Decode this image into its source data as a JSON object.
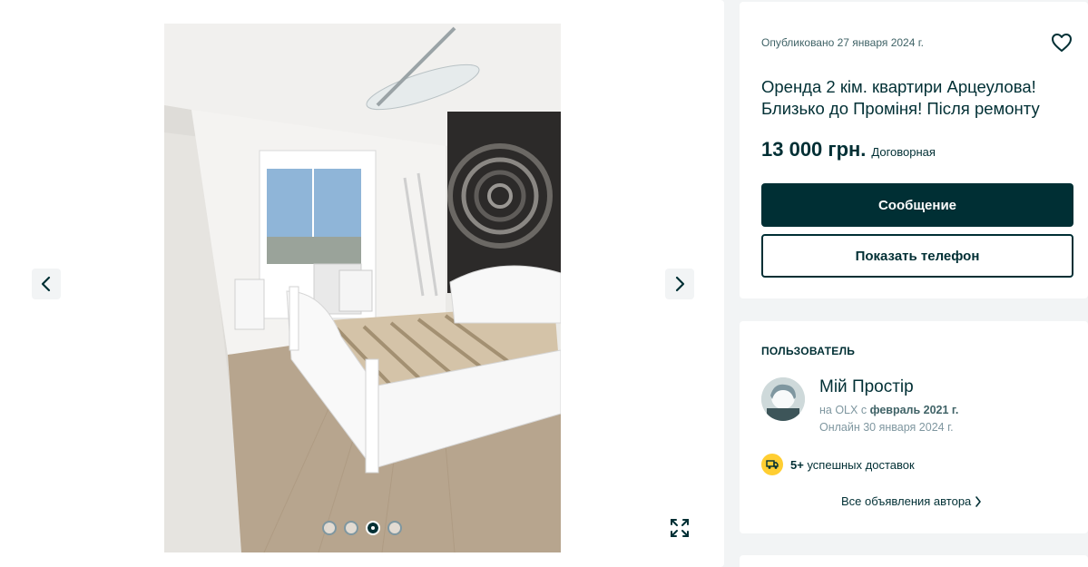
{
  "gallery": {
    "photo_alt": "bedroom",
    "dots_total": 4,
    "active_dot": 3
  },
  "offer": {
    "published": "Опубликовано 27 января 2024 г.",
    "title": "Оренда 2 кім. квартири Арцеулова! Близько до Проміня! Після ремонту",
    "price": "13 000 грн.",
    "negotiable": "Договорная",
    "message_button": "Сообщение",
    "phone_button": "Показать телефон"
  },
  "user": {
    "heading": "ПОЛЬЗОВАТЕЛЬ",
    "name": "Мій Простір",
    "since_prefix": "на OLX с",
    "since_value": "февраль 2021 г.",
    "online": "Онлайн 30 января 2024 г.",
    "deliveries_count": "5+",
    "deliveries_label": "успешных доставок",
    "all_ads": "Все объявления автора"
  },
  "colors": {
    "accent": "#002f34",
    "delivery_badge": "#ffce32",
    "page_bg": "#f2f4f5"
  },
  "icons": [
    "chevron-left-icon",
    "chevron-right-icon",
    "expand-icon",
    "heart-icon",
    "truck-icon",
    "chevron-right-small-icon"
  ]
}
